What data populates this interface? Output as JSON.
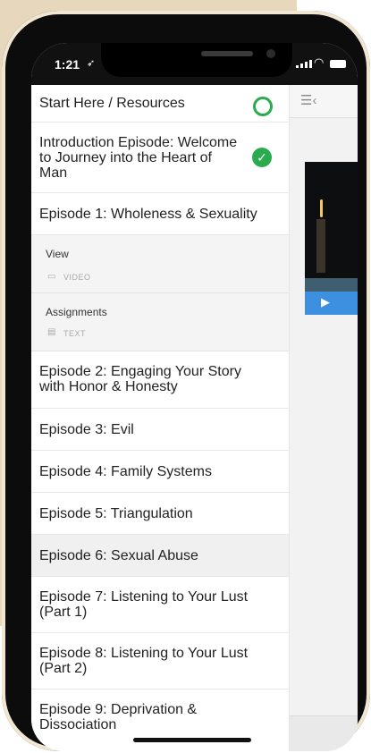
{
  "status_bar": {
    "time": "1:21",
    "time_icon": "location-arrow-icon"
  },
  "sidebar": {
    "collapse_icon": "collapse-panel-icon",
    "items": [
      {
        "label": "Start Here / Resources",
        "status": "incomplete-circle-icon"
      },
      {
        "label": "Introduction Episode: Welcome to Journey into the Heart of Man",
        "status": "complete-check-icon"
      },
      {
        "label": "Episode 1: Wholeness & Sexuality"
      },
      {
        "label": "Episode 2: Engaging Your Story with Honor & Honesty"
      },
      {
        "label": "Episode 3: Evil"
      },
      {
        "label": "Episode 4: Family Systems"
      },
      {
        "label": "Episode 5: Triangulation"
      },
      {
        "label": "Episode 6: Sexual Abuse"
      },
      {
        "label": "Episode 7: Listening to Your Lust (Part 1)"
      },
      {
        "label": "Episode 8: Listening to Your Lust (Part 2)"
      },
      {
        "label": "Episode 9: Deprivation & Dissociation"
      }
    ],
    "episode1_sub": [
      {
        "title": "View",
        "tag": "VIDEO",
        "icon": "video-camera-icon"
      },
      {
        "title": "Assignments",
        "tag": "TEXT",
        "icon": "document-icon"
      }
    ]
  },
  "colors": {
    "accent_green": "#2aab4e",
    "player_blue": "#3d8fe0",
    "frame_beige": "#e7d8bd"
  }
}
